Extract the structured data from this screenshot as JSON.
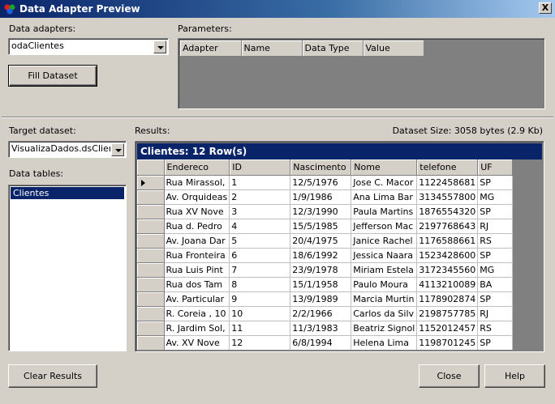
{
  "window": {
    "title": "Data Adapter Preview",
    "close_glyph": "X"
  },
  "adapters": {
    "label": "Data adapters:",
    "selected": "odaClientes"
  },
  "fill_button": "Fill Dataset",
  "parameters": {
    "label": "Parameters:",
    "columns": [
      "Adapter",
      "Name",
      "Data Type",
      "Value"
    ]
  },
  "target": {
    "label": "Target dataset:",
    "selected": "VisualizaDados.dsClientes"
  },
  "tables": {
    "label": "Data tables:",
    "items": [
      "Clientes"
    ]
  },
  "results": {
    "label": "Results:",
    "dataset_size": "Dataset Size: 3058 bytes (2.9 Kb)",
    "caption": "Clientes: 12 Row(s)",
    "columns": [
      "Endereco",
      "ID",
      "Nascimento",
      "Nome",
      "telefone",
      "UF"
    ],
    "rows": [
      [
        "Rua Mirassol,",
        "1",
        "12/5/1976",
        "Jose C. Macor",
        "1122458681",
        "SP"
      ],
      [
        "Av. Orquideas",
        "2",
        "1/9/1986",
        "Ana Lima Bar",
        "3134557800",
        "MG"
      ],
      [
        "Rua XV Nove",
        "3",
        "12/3/1990",
        "Paula Martins",
        "1876554320",
        "SP"
      ],
      [
        "Rua d. Pedro",
        "4",
        "15/5/1985",
        "Jefferson Mac",
        "2197768643",
        "RJ"
      ],
      [
        "Av. Joana Dar",
        "5",
        "20/4/1975",
        "Janice Rachel",
        "1176588661",
        "RS"
      ],
      [
        "Rua Fronteira",
        "6",
        "18/6/1992",
        "Jessica Naara",
        "1523428600",
        "SP"
      ],
      [
        "Rua Luis Pint",
        "7",
        "23/9/1978",
        "Miriam Estela",
        "3172345560",
        "MG"
      ],
      [
        "Rua dos Tam",
        "8",
        "15/1/1958",
        "Paulo Moura",
        "4113210089",
        "BA"
      ],
      [
        "Av. Particular",
        "9",
        "13/9/1989",
        "Marcia Murtin",
        "1178902874",
        "SP"
      ],
      [
        "R. Coreia , 10",
        "10",
        "2/2/1966",
        "Carlos da Silv",
        "2198757785",
        "RJ"
      ],
      [
        "R. Jardim Sol,",
        "11",
        "11/3/1983",
        "Beatriz Signol",
        "1152012457",
        "RS"
      ],
      [
        "Av. XV Nove",
        "12",
        "6/8/1994",
        "Helena Lima",
        "1198701245",
        "SP"
      ]
    ]
  },
  "buttons": {
    "clear": "Clear Results",
    "close": "Close",
    "help": "Help"
  },
  "colors": {
    "titlebar": "#0a246a",
    "face": "#d4d0c8",
    "selection": "#0a246a"
  }
}
